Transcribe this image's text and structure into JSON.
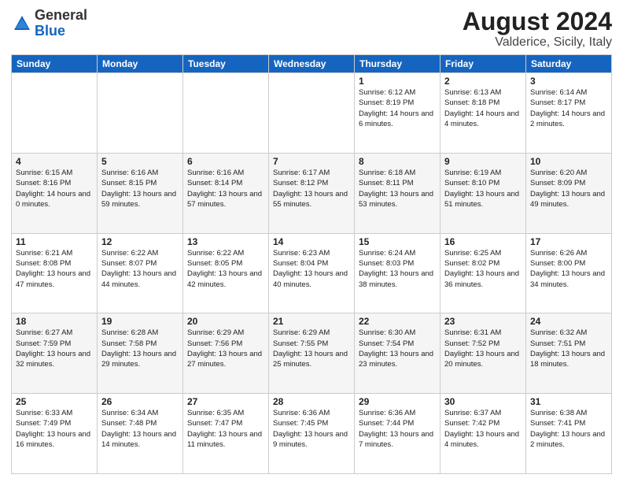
{
  "header": {
    "logo_general": "General",
    "logo_blue": "Blue",
    "month_title": "August 2024",
    "location": "Valderice, Sicily, Italy"
  },
  "weekdays": [
    "Sunday",
    "Monday",
    "Tuesday",
    "Wednesday",
    "Thursday",
    "Friday",
    "Saturday"
  ],
  "weeks": [
    [
      {
        "day": "",
        "info": ""
      },
      {
        "day": "",
        "info": ""
      },
      {
        "day": "",
        "info": ""
      },
      {
        "day": "",
        "info": ""
      },
      {
        "day": "1",
        "info": "Sunrise: 6:12 AM\nSunset: 8:19 PM\nDaylight: 14 hours and 6 minutes."
      },
      {
        "day": "2",
        "info": "Sunrise: 6:13 AM\nSunset: 8:18 PM\nDaylight: 14 hours and 4 minutes."
      },
      {
        "day": "3",
        "info": "Sunrise: 6:14 AM\nSunset: 8:17 PM\nDaylight: 14 hours and 2 minutes."
      }
    ],
    [
      {
        "day": "4",
        "info": "Sunrise: 6:15 AM\nSunset: 8:16 PM\nDaylight: 14 hours and 0 minutes."
      },
      {
        "day": "5",
        "info": "Sunrise: 6:16 AM\nSunset: 8:15 PM\nDaylight: 13 hours and 59 minutes."
      },
      {
        "day": "6",
        "info": "Sunrise: 6:16 AM\nSunset: 8:14 PM\nDaylight: 13 hours and 57 minutes."
      },
      {
        "day": "7",
        "info": "Sunrise: 6:17 AM\nSunset: 8:12 PM\nDaylight: 13 hours and 55 minutes."
      },
      {
        "day": "8",
        "info": "Sunrise: 6:18 AM\nSunset: 8:11 PM\nDaylight: 13 hours and 53 minutes."
      },
      {
        "day": "9",
        "info": "Sunrise: 6:19 AM\nSunset: 8:10 PM\nDaylight: 13 hours and 51 minutes."
      },
      {
        "day": "10",
        "info": "Sunrise: 6:20 AM\nSunset: 8:09 PM\nDaylight: 13 hours and 49 minutes."
      }
    ],
    [
      {
        "day": "11",
        "info": "Sunrise: 6:21 AM\nSunset: 8:08 PM\nDaylight: 13 hours and 47 minutes."
      },
      {
        "day": "12",
        "info": "Sunrise: 6:22 AM\nSunset: 8:07 PM\nDaylight: 13 hours and 44 minutes."
      },
      {
        "day": "13",
        "info": "Sunrise: 6:22 AM\nSunset: 8:05 PM\nDaylight: 13 hours and 42 minutes."
      },
      {
        "day": "14",
        "info": "Sunrise: 6:23 AM\nSunset: 8:04 PM\nDaylight: 13 hours and 40 minutes."
      },
      {
        "day": "15",
        "info": "Sunrise: 6:24 AM\nSunset: 8:03 PM\nDaylight: 13 hours and 38 minutes."
      },
      {
        "day": "16",
        "info": "Sunrise: 6:25 AM\nSunset: 8:02 PM\nDaylight: 13 hours and 36 minutes."
      },
      {
        "day": "17",
        "info": "Sunrise: 6:26 AM\nSunset: 8:00 PM\nDaylight: 13 hours and 34 minutes."
      }
    ],
    [
      {
        "day": "18",
        "info": "Sunrise: 6:27 AM\nSunset: 7:59 PM\nDaylight: 13 hours and 32 minutes."
      },
      {
        "day": "19",
        "info": "Sunrise: 6:28 AM\nSunset: 7:58 PM\nDaylight: 13 hours and 29 minutes."
      },
      {
        "day": "20",
        "info": "Sunrise: 6:29 AM\nSunset: 7:56 PM\nDaylight: 13 hours and 27 minutes."
      },
      {
        "day": "21",
        "info": "Sunrise: 6:29 AM\nSunset: 7:55 PM\nDaylight: 13 hours and 25 minutes."
      },
      {
        "day": "22",
        "info": "Sunrise: 6:30 AM\nSunset: 7:54 PM\nDaylight: 13 hours and 23 minutes."
      },
      {
        "day": "23",
        "info": "Sunrise: 6:31 AM\nSunset: 7:52 PM\nDaylight: 13 hours and 20 minutes."
      },
      {
        "day": "24",
        "info": "Sunrise: 6:32 AM\nSunset: 7:51 PM\nDaylight: 13 hours and 18 minutes."
      }
    ],
    [
      {
        "day": "25",
        "info": "Sunrise: 6:33 AM\nSunset: 7:49 PM\nDaylight: 13 hours and 16 minutes."
      },
      {
        "day": "26",
        "info": "Sunrise: 6:34 AM\nSunset: 7:48 PM\nDaylight: 13 hours and 14 minutes."
      },
      {
        "day": "27",
        "info": "Sunrise: 6:35 AM\nSunset: 7:47 PM\nDaylight: 13 hours and 11 minutes."
      },
      {
        "day": "28",
        "info": "Sunrise: 6:36 AM\nSunset: 7:45 PM\nDaylight: 13 hours and 9 minutes."
      },
      {
        "day": "29",
        "info": "Sunrise: 6:36 AM\nSunset: 7:44 PM\nDaylight: 13 hours and 7 minutes."
      },
      {
        "day": "30",
        "info": "Sunrise: 6:37 AM\nSunset: 7:42 PM\nDaylight: 13 hours and 4 minutes."
      },
      {
        "day": "31",
        "info": "Sunrise: 6:38 AM\nSunset: 7:41 PM\nDaylight: 13 hours and 2 minutes."
      }
    ]
  ]
}
